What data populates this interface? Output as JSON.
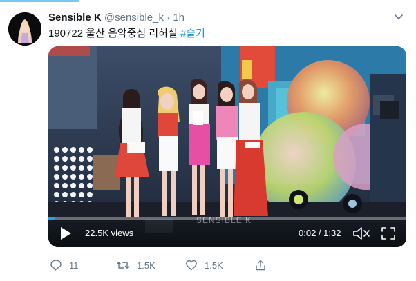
{
  "tweet": {
    "display_name": "Sensible K",
    "handle": "@sensible_k",
    "separator": "·",
    "time": "1h",
    "text_plain": "190722 울산 음악중심 리허설 ",
    "hashtag": "#슬기",
    "caret_icon": "chevron-down-icon",
    "avatar_icon": "profile-avatar"
  },
  "video": {
    "views": "22.5K views",
    "watermark": "SENSIBLE K",
    "current_time": "0:02",
    "duration": "1:32",
    "timecode": "0:02 / 1:32",
    "progress": 0.02,
    "controls": {
      "play_icon": "play-icon",
      "mute_icon": "volume-muted-icon",
      "fullscreen_icon": "fullscreen-icon"
    }
  },
  "actions": {
    "reply_count": "11",
    "retweet_count": "1.5K",
    "like_count": "1.5K",
    "icons": [
      "reply-icon",
      "retweet-icon",
      "like-icon",
      "share-icon"
    ]
  },
  "colors": {
    "accent": "#1da1f2",
    "hashtag": "#1b95e0",
    "secondary_text": "#657786",
    "primary_text": "#14171a"
  }
}
